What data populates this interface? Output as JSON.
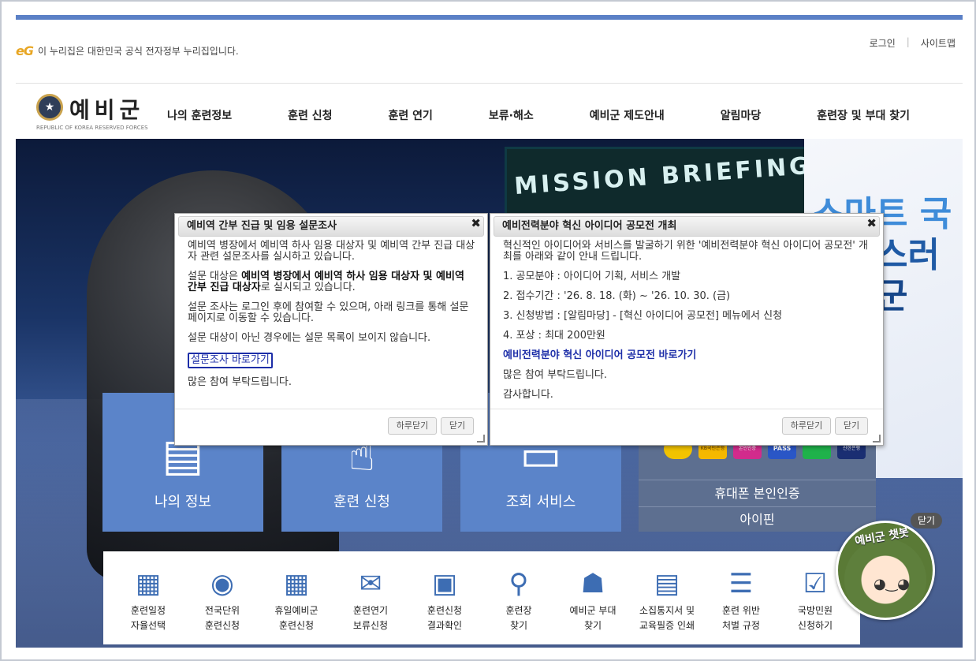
{
  "gov_banner": {
    "logo_text": "eG",
    "text": "이 누리집은 대한민국 공식 전자정부 누리집입니다."
  },
  "util": {
    "login": "로그인",
    "sitemap": "사이트맵"
  },
  "logo": {
    "title": "예비군",
    "subtitle": "REPUBLIC OF KOREA RESERVED FORCES"
  },
  "nav": [
    "나의 훈련정보",
    "훈련 신청",
    "훈련 연기",
    "보류·해소",
    "예비군 제도안내",
    "알림마당",
    "훈련장 및 부대 찾기"
  ],
  "hero": {
    "screen_text": "MISSION  BRIEFING",
    "slogan": [
      "스마트 국",
      "자랑스러",
      "예비군"
    ]
  },
  "services": [
    {
      "label": "나의 정보",
      "icon": "document-pencil-icon"
    },
    {
      "label": "훈련 신청",
      "icon": "hand-keyboard-icon"
    },
    {
      "label": "조회 서비스",
      "icon": "monitor-book-icon"
    }
  ],
  "auth": {
    "banks": [
      "",
      "KB국민은행",
      "본인인증",
      "PASS",
      "",
      "신한은행"
    ],
    "phone": "휴대폰 본인인증",
    "ipin": "아이핀"
  },
  "quick": [
    {
      "label": "훈련일정\n자율선택",
      "icon": "calendar-icon"
    },
    {
      "label": "전국단위\n훈련신청",
      "icon": "globe-user-icon"
    },
    {
      "label": "휴일예비군\n훈련신청",
      "icon": "calendar-search-icon"
    },
    {
      "label": "훈련연기\n보류신청",
      "icon": "mail-icon"
    },
    {
      "label": "훈련신청\n결과확인",
      "icon": "id-card-icon"
    },
    {
      "label": "훈련장\n찾기",
      "icon": "map-pin-icon"
    },
    {
      "label": "예비군 부대\n찾기",
      "icon": "people-group-icon"
    },
    {
      "label": "소집통지서 및\n교육필증 인쇄",
      "icon": "printer-icon"
    },
    {
      "label": "훈련 위반\n처벌 규정",
      "icon": "teacher-board-icon"
    },
    {
      "label": "국방민원\n신청하기",
      "icon": "clipboard-check-icon"
    }
  ],
  "popup1": {
    "title": "예비역 간부 진급 및 임용 설문조사",
    "p1": "예비역 병장에서 예비역 하사 임용 대상자 및 예비역 간부 진급 대상자 관련 설문조사를 실시하고 있습니다.",
    "p2_pre": "설문 대상은 ",
    "p2_bold": "예비역 병장에서 예비역 하사 임용 대상자 및 예비역 간부 진급 대상자",
    "p2_post": "로 실시되고 있습니다.",
    "p3": "설문 조사는 로그인 후에 참여할 수 있으며, 아래 링크를 통해 설문 페이지로 이동할 수 있습니다.",
    "p4": "설문 대상이 아닌 경우에는 설문 목록이 보이지 않습니다.",
    "link": "설문조사 바로가기",
    "p5": "많은 참여 부탁드립니다.",
    "btn_day": "하루닫기",
    "btn_close": "닫기"
  },
  "popup2": {
    "title": "예비전력분야 혁신 아이디어 공모전 개최",
    "p1": "혁신적인 아이디어와 서비스를 발굴하기 위한 '예비전력분야 혁신 아이디어 공모전' 개최를 아래와 같이 안내 드립니다.",
    "items": [
      "1. 공모분야 : 아이디어 기획, 서비스 개발",
      "2. 접수기간 : '26. 8. 18. (화) ~ '26. 10. 30. (금)",
      "3. 신청방법 : [알림마당] - [혁신 아이디어 공모전] 메뉴에서 신청",
      "4. 포상 : 최대 200만원"
    ],
    "link": "예비전력분야 혁신 아이디어 공모전 바로가기",
    "p5": "많은 참여 부탁드립니다.",
    "p6": "감사합니다.",
    "btn_day": "하루닫기",
    "btn_close": "닫기"
  },
  "chatbot": {
    "label": "예비군 챗봇",
    "close": "닫기"
  },
  "colors": {
    "accent": "#5b80c6",
    "service_tile": "#5b84c9",
    "auth_panel": "#5d6f90",
    "link": "#1d2ea8"
  }
}
